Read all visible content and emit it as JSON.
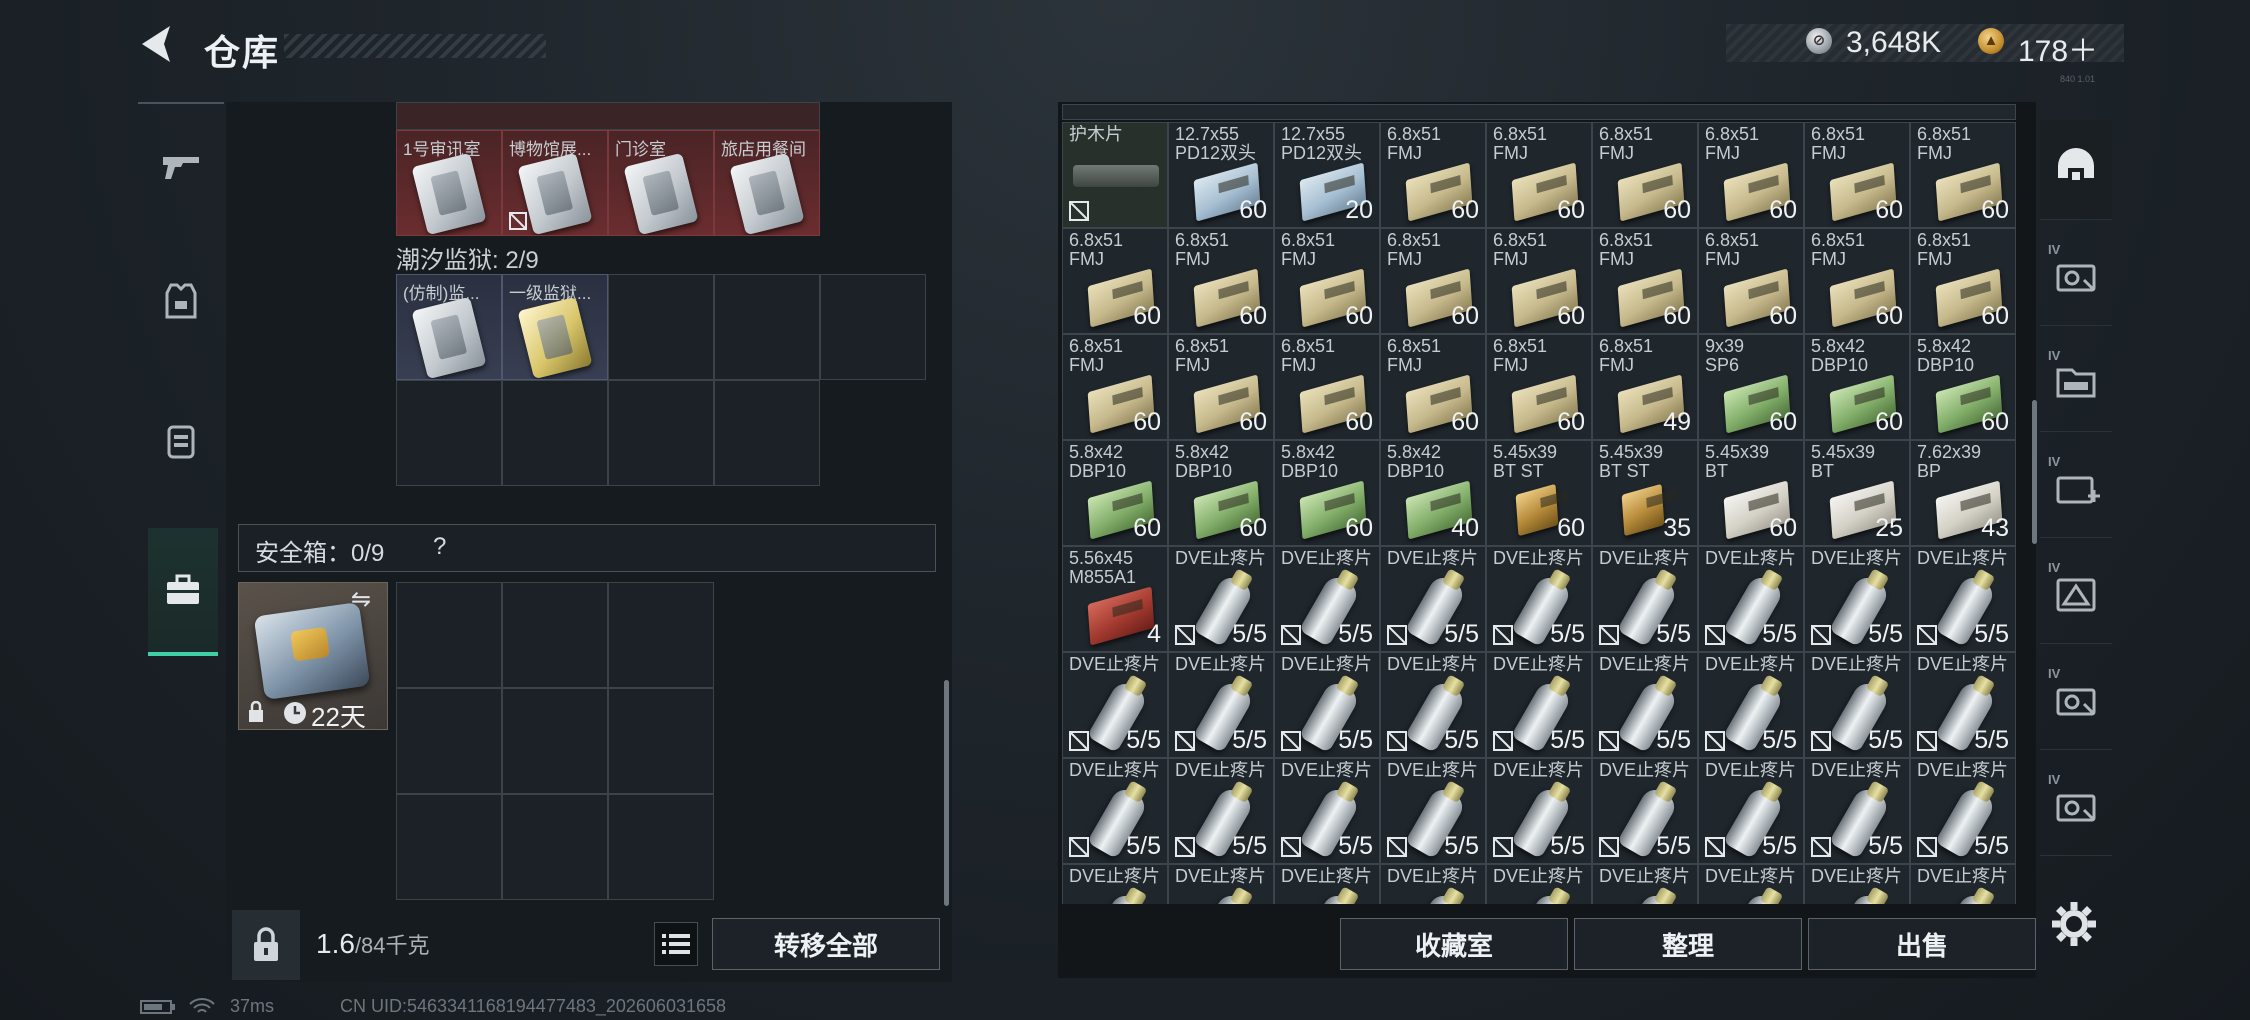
{
  "header": {
    "back_icon": "back-arrow-icon",
    "title": "仓库"
  },
  "currency": {
    "silver_value": "3,648K",
    "gold_value": "178＋",
    "version_stamp": "840 1.01"
  },
  "left_tabs": [
    {
      "name": "weapon",
      "icon": "gun-icon"
    },
    {
      "name": "armor",
      "icon": "vest-icon"
    },
    {
      "name": "backpack",
      "icon": "backpack-icon"
    },
    {
      "name": "safebox",
      "icon": "briefcase-icon",
      "active": true
    }
  ],
  "keys_top": [
    {
      "label": "1号审讯室"
    },
    {
      "label": "博物馆展..."
    },
    {
      "label": "门诊室"
    },
    {
      "label": "旅店用餐间"
    }
  ],
  "prison": {
    "label": "潮汐监狱: 2/9",
    "items": [
      {
        "label": "(仿制)监..."
      },
      {
        "label": "一级监狱..."
      }
    ]
  },
  "safebox": {
    "label": "安全箱：0/9",
    "help": "?",
    "duration": "22天"
  },
  "weight": {
    "value": "1.6",
    "unit": "/84千克"
  },
  "buttons": {
    "transfer_all": "转移全部",
    "collection": "收藏室",
    "organize": "整理",
    "sell": "出售"
  },
  "inventory_rows": [
    [
      {
        "label": "护木片",
        "count": "",
        "type": "grip",
        "nt": true
      },
      {
        "label": "12.7x55\nPD12双头",
        "count": "60",
        "type": "blue"
      },
      {
        "label": "12.7x55\nPD12双头",
        "count": "20",
        "type": "blue"
      },
      {
        "label": "6.8x51\nFMJ",
        "count": "60",
        "type": "tan"
      },
      {
        "label": "6.8x51\nFMJ",
        "count": "60",
        "type": "tan"
      },
      {
        "label": "6.8x51\nFMJ",
        "count": "60",
        "type": "tan"
      },
      {
        "label": "6.8x51\nFMJ",
        "count": "60",
        "type": "tan"
      },
      {
        "label": "6.8x51\nFMJ",
        "count": "60",
        "type": "tan"
      },
      {
        "label": "6.8x51\nFMJ",
        "count": "60",
        "type": "tan"
      }
    ],
    [
      {
        "label": "6.8x51\nFMJ",
        "count": "60",
        "type": "tan"
      },
      {
        "label": "6.8x51\nFMJ",
        "count": "60",
        "type": "tan"
      },
      {
        "label": "6.8x51\nFMJ",
        "count": "60",
        "type": "tan"
      },
      {
        "label": "6.8x51\nFMJ",
        "count": "60",
        "type": "tan"
      },
      {
        "label": "6.8x51\nFMJ",
        "count": "60",
        "type": "tan"
      },
      {
        "label": "6.8x51\nFMJ",
        "count": "60",
        "type": "tan"
      },
      {
        "label": "6.8x51\nFMJ",
        "count": "60",
        "type": "tan"
      },
      {
        "label": "6.8x51\nFMJ",
        "count": "60",
        "type": "tan"
      },
      {
        "label": "6.8x51\nFMJ",
        "count": "60",
        "type": "tan"
      }
    ],
    [
      {
        "label": "6.8x51\nFMJ",
        "count": "60",
        "type": "tan"
      },
      {
        "label": "6.8x51\nFMJ",
        "count": "60",
        "type": "tan"
      },
      {
        "label": "6.8x51\nFMJ",
        "count": "60",
        "type": "tan"
      },
      {
        "label": "6.8x51\nFMJ",
        "count": "60",
        "type": "tan"
      },
      {
        "label": "6.8x51\nFMJ",
        "count": "60",
        "type": "tan"
      },
      {
        "label": "6.8x51\nFMJ",
        "count": "49",
        "type": "tan"
      },
      {
        "label": "9x39\nSP6",
        "count": "60",
        "type": "green"
      },
      {
        "label": "5.8x42\nDBP10",
        "count": "60",
        "type": "green"
      },
      {
        "label": "5.8x42\nDBP10",
        "count": "60",
        "type": "green"
      }
    ],
    [
      {
        "label": "5.8x42\nDBP10",
        "count": "60",
        "type": "green"
      },
      {
        "label": "5.8x42\nDBP10",
        "count": "60",
        "type": "green"
      },
      {
        "label": "5.8x42\nDBP10",
        "count": "60",
        "type": "green"
      },
      {
        "label": "5.8x42\nDBP10",
        "count": "40",
        "type": "green"
      },
      {
        "label": "5.45x39\nBT ST",
        "count": "60",
        "type": "brass"
      },
      {
        "label": "5.45x39\nBT ST",
        "count": "35",
        "type": "brass"
      },
      {
        "label": "5.45x39\nBT",
        "count": "60",
        "type": "white"
      },
      {
        "label": "5.45x39\nBT",
        "count": "25",
        "type": "white"
      },
      {
        "label": "7.62x39\nBP",
        "count": "43",
        "type": "white"
      }
    ],
    [
      {
        "label": "5.56x45\nM855A1",
        "count": "4",
        "type": "red"
      },
      {
        "label": "DVE止疼片",
        "count": "5/5",
        "type": "pill",
        "nt": true
      },
      {
        "label": "DVE止疼片",
        "count": "5/5",
        "type": "pill",
        "nt": true
      },
      {
        "label": "DVE止疼片",
        "count": "5/5",
        "type": "pill",
        "nt": true
      },
      {
        "label": "DVE止疼片",
        "count": "5/5",
        "type": "pill",
        "nt": true
      },
      {
        "label": "DVE止疼片",
        "count": "5/5",
        "type": "pill",
        "nt": true
      },
      {
        "label": "DVE止疼片",
        "count": "5/5",
        "type": "pill",
        "nt": true
      },
      {
        "label": "DVE止疼片",
        "count": "5/5",
        "type": "pill",
        "nt": true
      },
      {
        "label": "DVE止疼片",
        "count": "5/5",
        "type": "pill",
        "nt": true
      }
    ],
    [
      {
        "label": "DVE止疼片",
        "count": "5/5",
        "type": "pill",
        "nt": true
      },
      {
        "label": "DVE止疼片",
        "count": "5/5",
        "type": "pill",
        "nt": true
      },
      {
        "label": "DVE止疼片",
        "count": "5/5",
        "type": "pill",
        "nt": true
      },
      {
        "label": "DVE止疼片",
        "count": "5/5",
        "type": "pill",
        "nt": true
      },
      {
        "label": "DVE止疼片",
        "count": "5/5",
        "type": "pill",
        "nt": true
      },
      {
        "label": "DVE止疼片",
        "count": "5/5",
        "type": "pill",
        "nt": true
      },
      {
        "label": "DVE止疼片",
        "count": "5/5",
        "type": "pill",
        "nt": true
      },
      {
        "label": "DVE止疼片",
        "count": "5/5",
        "type": "pill",
        "nt": true
      },
      {
        "label": "DVE止疼片",
        "count": "5/5",
        "type": "pill",
        "nt": true
      }
    ],
    [
      {
        "label": "DVE止疼片",
        "count": "5/5",
        "type": "pill",
        "nt": true
      },
      {
        "label": "DVE止疼片",
        "count": "5/5",
        "type": "pill",
        "nt": true
      },
      {
        "label": "DVE止疼片",
        "count": "5/5",
        "type": "pill",
        "nt": true
      },
      {
        "label": "DVE止疼片",
        "count": "5/5",
        "type": "pill",
        "nt": true
      },
      {
        "label": "DVE止疼片",
        "count": "5/5",
        "type": "pill",
        "nt": true
      },
      {
        "label": "DVE止疼片",
        "count": "5/5",
        "type": "pill",
        "nt": true
      },
      {
        "label": "DVE止疼片",
        "count": "5/5",
        "type": "pill",
        "nt": true
      },
      {
        "label": "DVE止疼片",
        "count": "5/5",
        "type": "pill",
        "nt": true
      },
      {
        "label": "DVE止疼片",
        "count": "5/5",
        "type": "pill",
        "nt": true
      }
    ],
    [
      {
        "label": "DVE止疼片",
        "count": "",
        "type": "pill"
      },
      {
        "label": "DVE止疼片",
        "count": "",
        "type": "pill"
      },
      {
        "label": "DVE止疼片",
        "count": "",
        "type": "pill"
      },
      {
        "label": "DVE止疼片",
        "count": "",
        "type": "pill"
      },
      {
        "label": "DVE止疼片",
        "count": "",
        "type": "pill"
      },
      {
        "label": "DVE止疼片",
        "count": "",
        "type": "pill"
      },
      {
        "label": "DVE止疼片",
        "count": "",
        "type": "pill"
      },
      {
        "label": "DVE止疼片",
        "count": "",
        "type": "pill"
      },
      {
        "label": "DVE止疼片",
        "count": "",
        "type": "pill"
      }
    ]
  ],
  "right_tabs": [
    {
      "icon": "helmet-icon",
      "iv": ""
    },
    {
      "icon": "camera-box-icon",
      "iv": "IV"
    },
    {
      "icon": "folder-icon",
      "iv": "IV"
    },
    {
      "icon": "medkit-icon",
      "iv": "IV"
    },
    {
      "icon": "warning-box-icon",
      "iv": "IV"
    },
    {
      "icon": "camera-box-icon",
      "iv": "IV"
    },
    {
      "icon": "camera-box-icon",
      "iv": "IV"
    }
  ],
  "status": {
    "ping": "37ms",
    "uid": "CN UID:5463341168194477483_202606031658"
  }
}
